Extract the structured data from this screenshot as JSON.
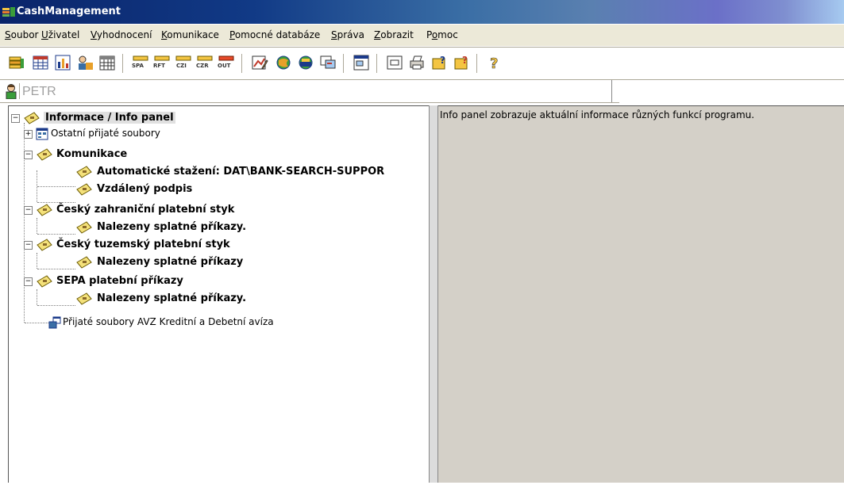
{
  "window": {
    "title": "CashManagement"
  },
  "menu": [
    {
      "label": "Soubor",
      "ul": "S"
    },
    {
      "label": "Uživatel",
      "ul": "U"
    },
    {
      "label": "Vyhodnocení",
      "ul": "V"
    },
    {
      "label": "Komunikace",
      "ul": "K"
    },
    {
      "label": "Pomocné databáze",
      "ul": "P"
    },
    {
      "label": "Správa",
      "ul": "S"
    },
    {
      "label": "Zobrazit",
      "ul": "Z"
    },
    {
      "label": "Pomoc",
      "ul": "o"
    }
  ],
  "toolbar": {
    "labels": [
      "SPA",
      "RFT",
      "CZI",
      "CZR",
      "OUT"
    ]
  },
  "user": {
    "name": "PETR"
  },
  "tree": [
    {
      "label": "Informace / Info panel",
      "bold": true,
      "selected": true
    },
    {
      "label": "Ostatní přijaté soubory",
      "bold": false
    },
    {
      "label": "Komunikace",
      "bold": true
    },
    {
      "label": "Automatické stažení: DAT\\BANK-SEARCH-SUPPOR",
      "bold": true
    },
    {
      "label": "Vzdálený podpis",
      "bold": true
    },
    {
      "label": "Český zahraniční platební styk",
      "bold": true
    },
    {
      "label": "Nalezeny splatné příkazy.",
      "bold": true
    },
    {
      "label": "Český tuzemský platební styk",
      "bold": true
    },
    {
      "label": "Nalezeny splatné příkazy",
      "bold": true
    },
    {
      "label": "SEPA platební příkazy",
      "bold": true
    },
    {
      "label": "Nalezeny splatné příkazy.",
      "bold": true
    },
    {
      "label": "Přijaté soubory AVZ Kreditní a Debetní avíza",
      "bold": false
    }
  ],
  "info": {
    "text": "Info panel zobrazuje aktuální informace různých funkcí programu."
  }
}
